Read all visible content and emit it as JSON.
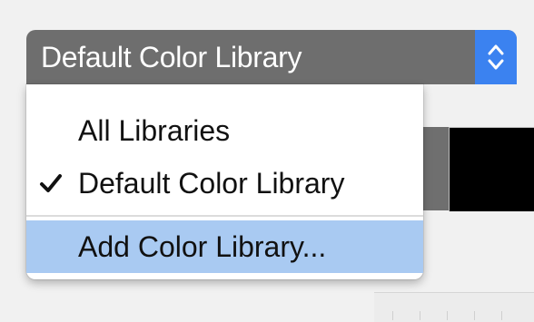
{
  "select": {
    "value": "Default Color Library",
    "icon": "chevron-up-down-icon"
  },
  "menu": {
    "items": [
      {
        "label": "All Libraries",
        "checked": false
      },
      {
        "label": "Default Color Library",
        "checked": true
      }
    ],
    "action": {
      "label": "Add Color Library...",
      "highlighted": true
    }
  },
  "colors": {
    "select_background": "#6e6e6e",
    "stepper_accent": "#3b82f0",
    "highlight": "#a9caf2",
    "swatch_gray": "#6f6f6f",
    "swatch_black": "#000000"
  }
}
